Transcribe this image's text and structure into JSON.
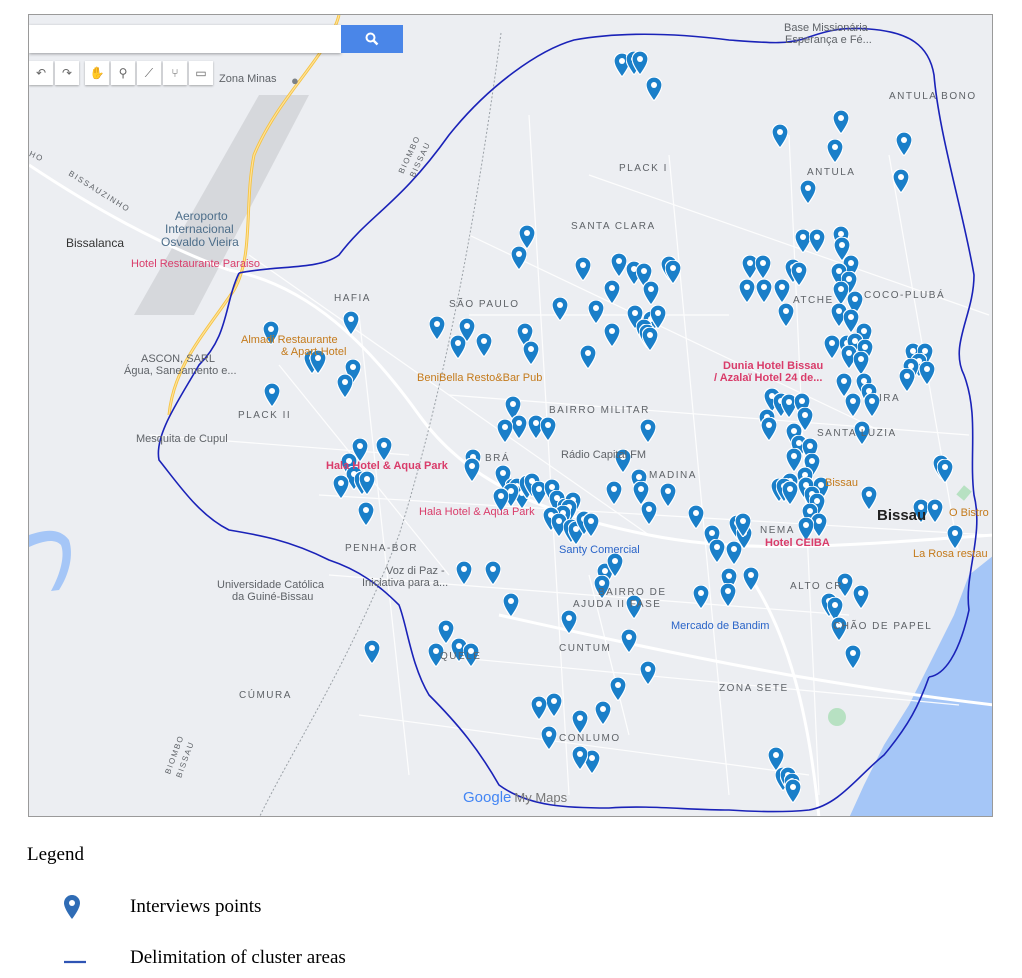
{
  "search": {
    "placeholder": "",
    "button_icon": "search-icon"
  },
  "toolbar": {
    "tools": [
      "undo-icon",
      "redo-icon",
      "hand-icon",
      "marker-icon",
      "line-icon",
      "route-icon",
      "ruler-icon"
    ]
  },
  "map": {
    "areas": {
      "plack_i": "PLACK I",
      "antula_bono": "ANTULA BONO",
      "antula": "ANTULA",
      "santa_clara": "SANTA CLARA",
      "hafia": "HAFIA",
      "sao_paulo": "SÃO PAULO",
      "atche": "ATCHE",
      "coco_pluba": "COCO-PLUBÁ",
      "bairro_militar": "BAIRRO MILITAR",
      "plack_ii": "PLACK II",
      "santa_luzia": "SANTA LUZIA",
      "bra": "BRÁ",
      "madina": "MADINA",
      "nema": "NEMA",
      "penha_bor": "PENHA-BOR",
      "bairro_de_ajuda": "BAIRRO DE",
      "bairro_de_ajuda_2": "AJUDA II FASE",
      "alto_cr": "ALTO CR",
      "chao_de_papel": "CHÃO DE PAPEL",
      "cuntum": "CUNTUM",
      "queli": "QUELE",
      "zona_sete": "ZONA SETE",
      "cumura": "CÚMURA",
      "conlumo": "CONLUMO",
      "bissalanca": "Bissalanca",
      "bissau": "Bissau",
      "ira": "IRA"
    },
    "roads": {
      "biombo_bissau_1": "BIOMBO",
      "biombo_bissau_1b": "BISSAU",
      "biombo_bissau_2": "BIOMBO",
      "biombo_bissau_2b": "BISSAU",
      "bissauzinho": "BISSAUZINHO",
      "ho": "HO"
    },
    "pois": {
      "zona_minas": "Zona Minas",
      "base_missionaria_1": "Base Missionária",
      "base_missionaria_2": "Esperança e Fé...",
      "aeroporto_1": "Aeroporto",
      "aeroporto_2": "Internacional",
      "aeroporto_3": "Osvaldo Vieira",
      "hotel_paraiso": "Hotel Restaurante Paraiso",
      "almadi_1": "Almadi Restaurante",
      "almadi_2": "& Apart-Hotel",
      "ascon_1": "ASCON, SARL",
      "ascon_2": "Água, Saneamento e...",
      "benibella": "BeniBella Resto&Bar Pub",
      "dunia_1": "Dunia Hotel Bissau",
      "dunia_2": "/ Azalaï Hotel 24 de...",
      "mesquita": "Mesquita de Cupul",
      "radio": "Rádio Capital FM",
      "hala_1": "Hala Hotel & Aqua Park",
      "hala_2": "Hala Hotel & Aqua Park",
      "bissau_poi": "Bissau",
      "bistro": "O Bistro",
      "santy": "Santy Comercial",
      "hotel_ceiba": "Hotel CEIBA",
      "la_rosa": "La Rosa restau",
      "voz_1": "Voz di Paz -",
      "voz_2": "Iniciativa para a...",
      "universidade_1": "Universidade Católica",
      "universidade_2": "da Guiné-Bissau",
      "mercado": "Mercado de Bandim"
    },
    "marker_color": "#1a7fc9",
    "boundary_color": "#1a22b8",
    "water_color": "#a5c6f7"
  },
  "branding": {
    "google": "Google",
    "mymaps": "My Maps"
  },
  "legend": {
    "title": "Legend",
    "items": [
      {
        "label": "Interviews points",
        "icon": "map-pin-icon"
      },
      {
        "label": "Delimitation of cluster areas",
        "icon": "line-icon"
      }
    ]
  }
}
